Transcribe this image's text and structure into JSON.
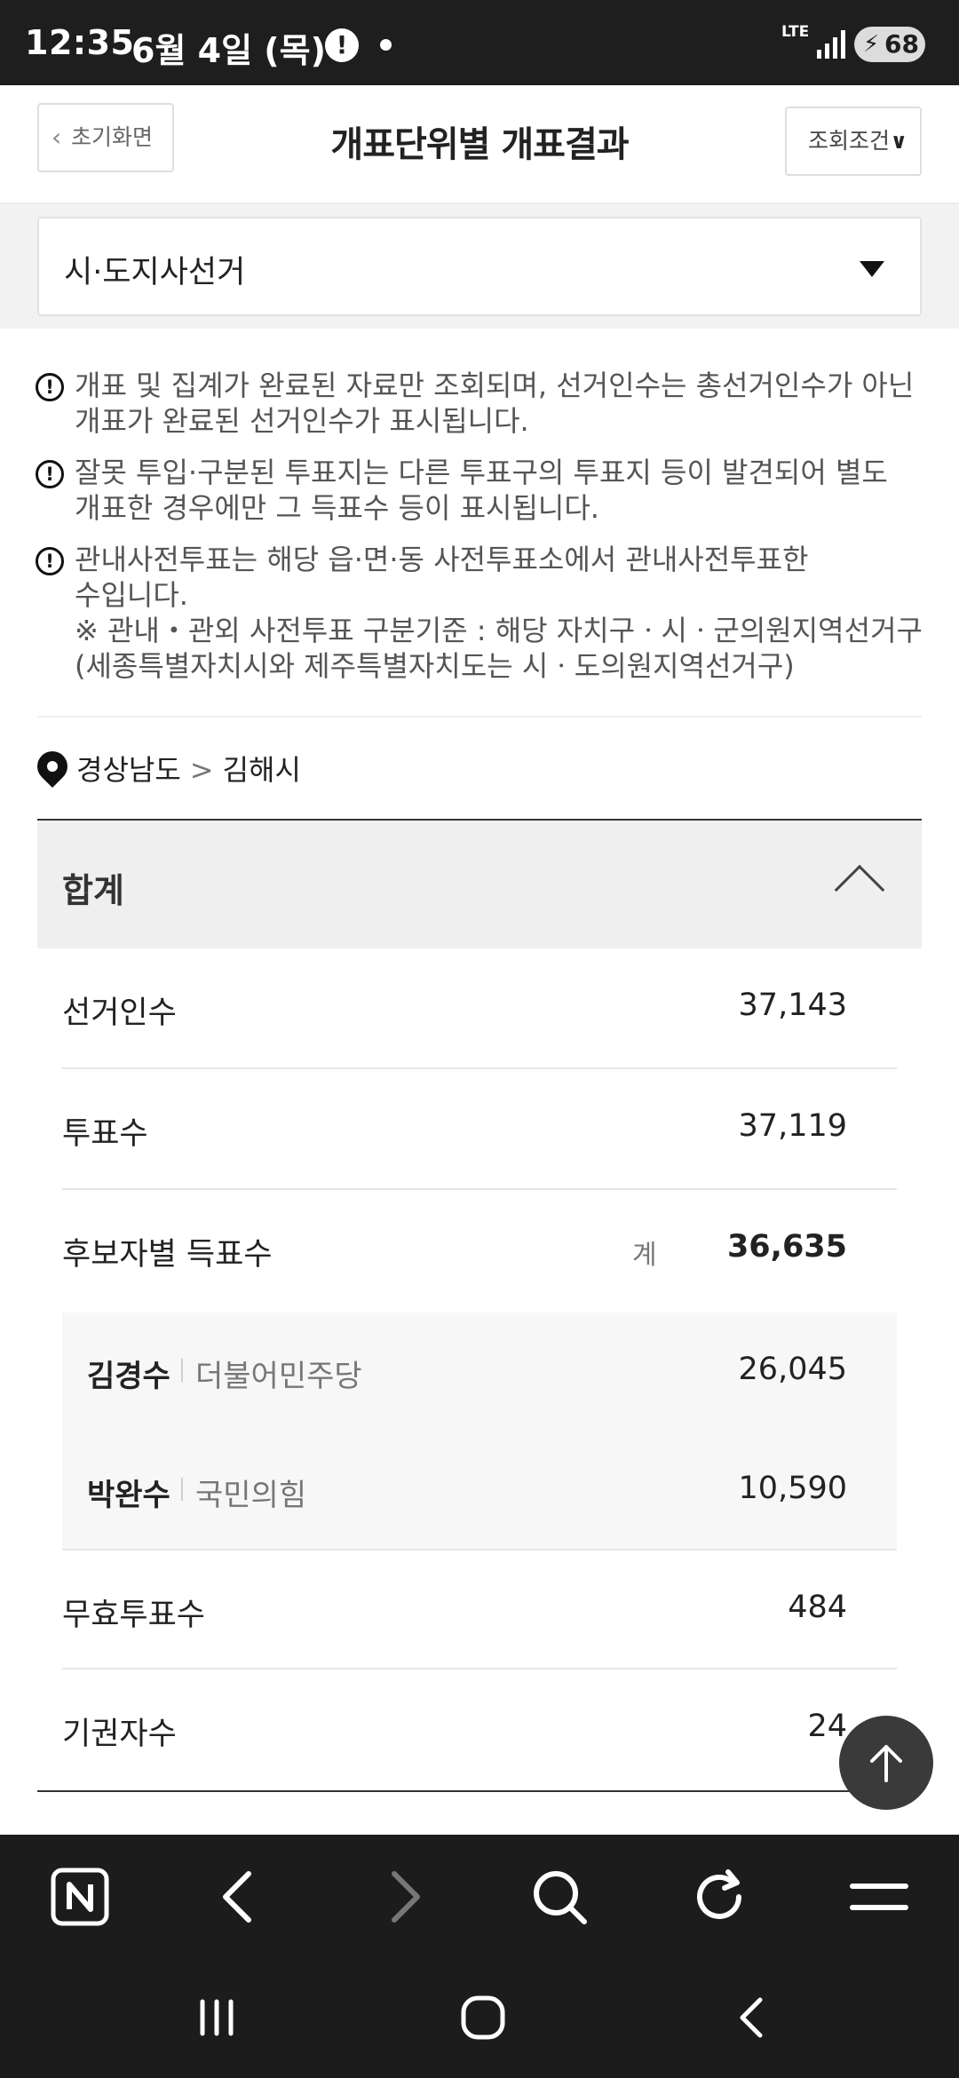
{
  "status_bar": {
    "time": "12:35",
    "date": "6월 4일 (목)",
    "alert_icon": "!",
    "network": "LTE",
    "battery": "68"
  },
  "header": {
    "home_label": "초기화면",
    "title": "개표단위별 개표결과",
    "filter_label": "조회조건"
  },
  "election_select": {
    "selected": "시·도지사선거"
  },
  "notices": [
    {
      "text": "개표 및 집계가 완료된 자료만 조회되며, 선거인수는 총선거인수가 아닌 개표가 완료된 선거인수가 표시됩니다."
    },
    {
      "text": "잘못 투입·구분된 투표지는 다른 투표구의 투표지 등이 발견되어 별도 개표한 경우에만 그 득표수 등이 표시됩니다."
    },
    {
      "text": "관내사전투표는 해당 읍·면·동 사전투표소에서 관내사전투표한 수입니다.",
      "sub": "※ 관내・관외 사전투표 구분기준 : 해당 자치구ㆍ시ㆍ군의원지역선거구(세종특별자치시와 제주특별자치도는 시ㆍ도의원지역선거구)"
    }
  ],
  "location": {
    "province": "경상남도",
    "separator": ">",
    "city": "김해시"
  },
  "summary": {
    "title": "합계",
    "electors_label": "선거인수",
    "electors_value": "37,143",
    "voters_label": "투표수",
    "voters_value": "37,119",
    "candidate_votes_label": "후보자별 득표수",
    "candidate_votes_sum_label": "계",
    "candidate_votes_total": "36,635",
    "candidates": [
      {
        "name": "김경수",
        "party": "더불어민주당",
        "votes": "26,045"
      },
      {
        "name": "박완수",
        "party": "국민의힘",
        "votes": "10,590"
      }
    ],
    "invalid_label": "무효투표수",
    "invalid_value": "484",
    "abstain_label": "기권자수",
    "abstain_value": "24"
  },
  "icons": {
    "scroll_top": "arrow-up-icon",
    "browser_home": "naver-n-icon",
    "back": "chevron-left-icon",
    "forward": "chevron-right-icon",
    "search": "search-icon",
    "reload": "reload-icon",
    "menu": "hamburger-icon"
  },
  "colors": {
    "status_bar_bg": "#1e1e1e",
    "browser_bar_bg": "#1c1c1c",
    "section_head_bg": "#efefef",
    "candidate_bg": "#f7f7f7"
  }
}
